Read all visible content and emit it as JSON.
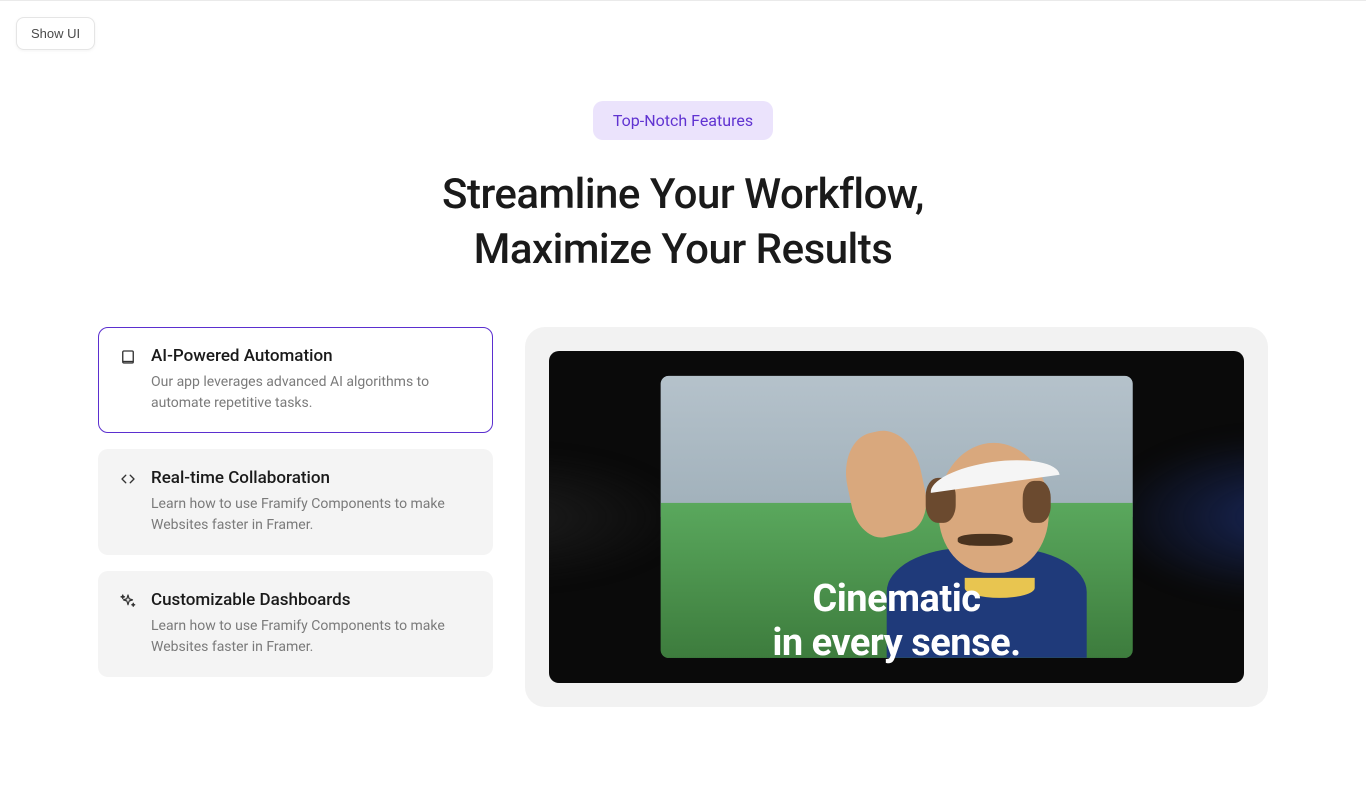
{
  "ui": {
    "show_ui_label": "Show UI"
  },
  "header": {
    "badge": "Top-Notch Features",
    "title_line1": "Streamline Your Workflow,",
    "title_line2": "Maximize Your Results"
  },
  "features": [
    {
      "icon": "book-icon",
      "title": "AI-Powered Automation",
      "desc": "Our app leverages advanced AI algorithms to automate repetitive tasks.",
      "active": true
    },
    {
      "icon": "code-icon",
      "title": "Real-time Collaboration",
      "desc": "Learn how to use Framify Components to make Websites faster in Framer.",
      "active": false
    },
    {
      "icon": "sparkle-icon",
      "title": "Customizable Dashboards",
      "desc": "Learn how to use Framify Components to make Websites faster in Framer.",
      "active": false
    }
  ],
  "media": {
    "overlay_line1": "Cinematic",
    "overlay_line2": "in every sense."
  }
}
